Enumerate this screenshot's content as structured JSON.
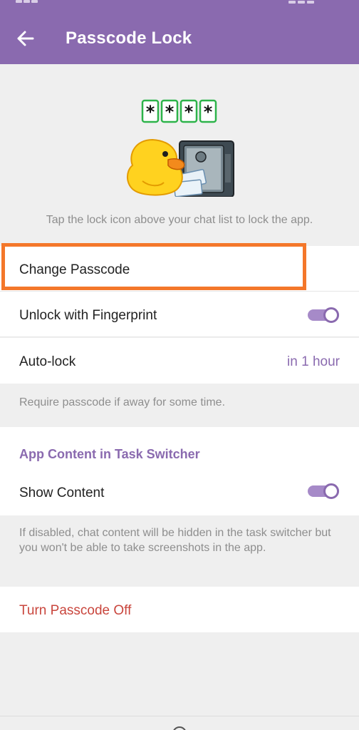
{
  "header": {
    "title": "Passcode Lock"
  },
  "hero": {
    "description": "Tap the lock icon above your chat list to lock the app.",
    "passcode_stars": [
      "*",
      "*",
      "*",
      "*"
    ]
  },
  "settings": {
    "change_passcode": "Change Passcode",
    "unlock_fingerprint": "Unlock with Fingerprint",
    "unlock_fingerprint_enabled": true,
    "auto_lock": "Auto-lock",
    "auto_lock_value": "in 1 hour",
    "auto_lock_note": "Require passcode if away for some time."
  },
  "task_switcher": {
    "section_title": "App Content in Task Switcher",
    "show_content": "Show Content",
    "show_content_enabled": true,
    "note": "If disabled, chat content will be hidden in the task switcher but you won't be able to take screenshots in the app."
  },
  "turn_off": "Turn Passcode Off",
  "colors": {
    "accent": "#8a6aaf",
    "highlight": "#f4772a",
    "danger": "#c9463d",
    "background": "#efefef"
  },
  "icons": {
    "back": "arrow-left-icon",
    "hero": "duck-safe-illustration"
  }
}
